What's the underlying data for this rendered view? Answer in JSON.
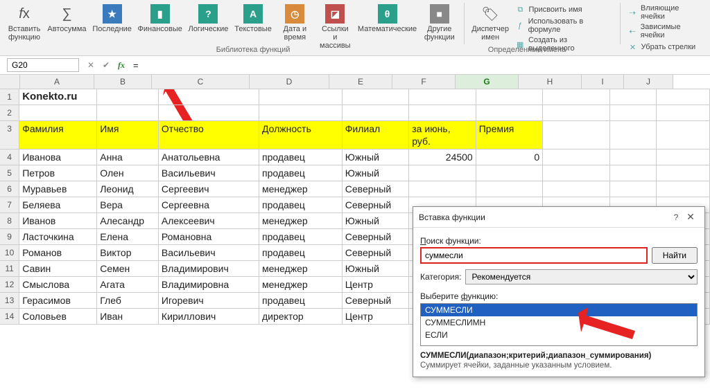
{
  "ribbon": {
    "insert_func": "Вставить\nфункцию",
    "autosum": "Автосумма",
    "recent": "Последние",
    "financial": "Финансовые",
    "logical": "Логические",
    "text": "Текстовые",
    "date": "Дата и\nвремя",
    "lookup": "Ссылки и\nмассивы",
    "math": "Математические",
    "other": "Другие\nфункции",
    "lib_title": "Библиотека функций",
    "name_mgr": "Диспетчер\nимен",
    "define_name": "Присвоить имя",
    "use_in_formula": "Использовать в формуле",
    "create_from_sel": "Создать из выделенного",
    "defined_names": "Определенные имена",
    "trace_prec": "Влияющие ячейки",
    "trace_dep": "Зависимые ячейки",
    "remove_arrows": "Убрать стрелки"
  },
  "fbar": {
    "cell_ref": "G20",
    "formula": "="
  },
  "columns": [
    "A",
    "B",
    "C",
    "D",
    "E",
    "F",
    "G",
    "H",
    "I",
    "J"
  ],
  "title_cell": "Konekto.ru",
  "headers": {
    "A": "Фамилия",
    "B": "Имя",
    "C": "Отчество",
    "D": "Должность",
    "E": "Филиал",
    "F": "за июнь,\nруб.",
    "G": "Премия"
  },
  "rows": [
    {
      "A": "Иванова",
      "B": "Анна",
      "C": "Анатольевна",
      "D": "продавец",
      "E": "Южный",
      "F": "24500",
      "G": "0"
    },
    {
      "A": "Петров",
      "B": "Олен",
      "C": "Васильевич",
      "D": "продавец",
      "E": "Южный",
      "F": "",
      "G": ""
    },
    {
      "A": "Муравьев",
      "B": "Леонид",
      "C": "Сергеевич",
      "D": "менеджер",
      "E": "Северный",
      "F": "",
      "G": ""
    },
    {
      "A": "Беляева",
      "B": "Вера",
      "C": "Сергеевна",
      "D": "продавец",
      "E": "Северный",
      "F": "",
      "G": ""
    },
    {
      "A": "Иванов",
      "B": "Алесандр",
      "C": "Алексеевич",
      "D": "менеджер",
      "E": "Южный",
      "F": "",
      "G": ""
    },
    {
      "A": "Ласточкина",
      "B": "Елена",
      "C": "Романовна",
      "D": "продавец",
      "E": "Северный",
      "F": "",
      "G": ""
    },
    {
      "A": "Романов",
      "B": "Виктор",
      "C": "Васильевич",
      "D": "продавец",
      "E": "Северный",
      "F": "",
      "G": ""
    },
    {
      "A": "Савин",
      "B": "Семен",
      "C": "Владимирович",
      "D": "менеджер",
      "E": "Южный",
      "F": "",
      "G": ""
    },
    {
      "A": "Смыслова",
      "B": "Агата",
      "C": "Владимировна",
      "D": "менеджер",
      "E": "Центр",
      "F": "",
      "G": ""
    },
    {
      "A": "Герасимов",
      "B": "Глеб",
      "C": "Игоревич",
      "D": "продавец",
      "E": "Северный",
      "F": "",
      "G": ""
    },
    {
      "A": "Соловьев",
      "B": "Иван",
      "C": "Кириллович",
      "D": "директор",
      "E": "Центр",
      "F": "",
      "G": ""
    }
  ],
  "dialog": {
    "title": "Вставка функции",
    "search_label": "Поиск функции:",
    "search_value": "суммесли",
    "find_btn": "Найти",
    "category_label": "Категория:",
    "category_value": "Рекомендуется",
    "select_label": "Выберите функцию:",
    "list": [
      "СУММЕСЛИ",
      "СУММЕСЛИМН",
      "ЕСЛИ"
    ],
    "signature": "СУММЕСЛИ(диапазон;критерий;диапазон_суммирования)",
    "description": "Суммирует ячейки, заданные указанным условием."
  }
}
